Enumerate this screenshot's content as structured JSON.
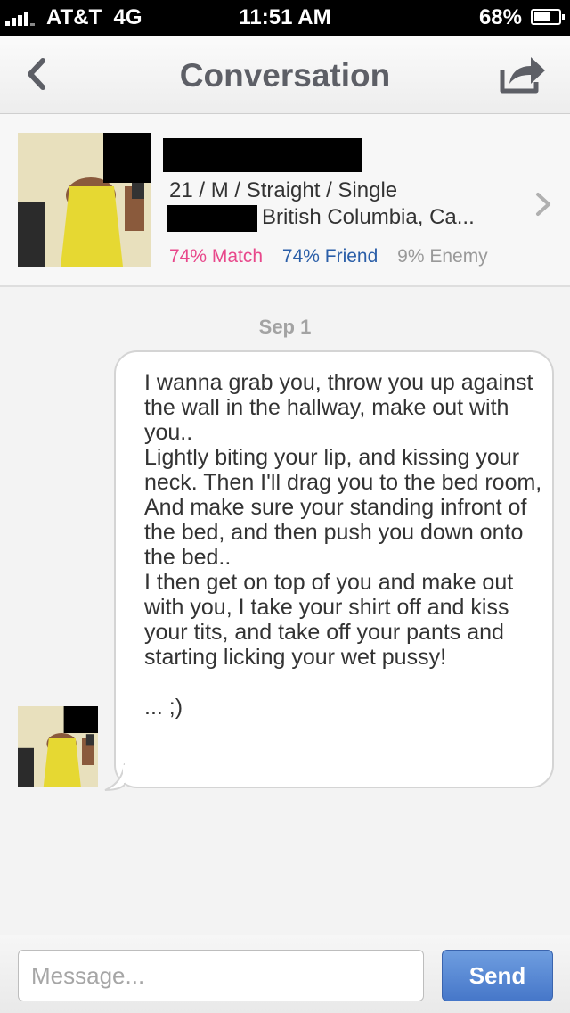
{
  "status_bar": {
    "carrier": "AT&T",
    "network": "4G",
    "time": "11:51 AM",
    "battery": "68%",
    "battery_level": 0.68
  },
  "nav": {
    "title": "Conversation",
    "back_icon": "chevron-left-icon",
    "share_icon": "share-icon"
  },
  "profile": {
    "details": "21 / M / Straight / Single",
    "location": "British Columbia, Ca...",
    "match": "74% Match",
    "friend": "74% Friend",
    "enemy": "9% Enemy",
    "colors": {
      "match": "#e8488b",
      "friend": "#2a5ea8",
      "enemy": "#999999"
    }
  },
  "conversation": {
    "date": "Sep 1",
    "messages": [
      {
        "text": "I wanna grab you, throw you up against the wall in the hallway, make out with you..\nLightly biting your lip, and kissing your neck. Then I'll drag you to the bed room,\nAnd make sure your standing infront of the bed, and then push you down onto the bed..\nI then get on top of you and make out with you, I take your shirt off and kiss your tits, and take off your pants and starting licking your wet pussy!\n\n... ;)"
      }
    ]
  },
  "input": {
    "placeholder": "Message...",
    "value": "",
    "send_label": "Send"
  }
}
